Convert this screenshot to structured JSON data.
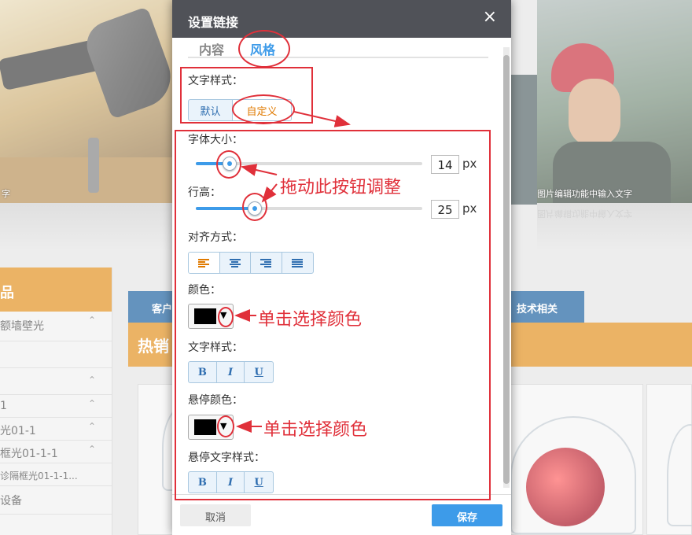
{
  "background": {
    "caption_left": "字",
    "caption_right": "图片编辑功能中输入文字",
    "caption_right_mirror": "图片编辑功能中输入文字",
    "sidebar_title": "品",
    "sidebar_items": [
      {
        "label": "额墙壁光",
        "chevron": "⌃"
      },
      {
        "label": "",
        "chevron": ""
      },
      {
        "label": "",
        "chevron": "⌃"
      },
      {
        "label": "1",
        "chevron": "⌃"
      },
      {
        "label": "光01-1",
        "chevron": "⌃"
      },
      {
        "label": "框光01-1-1",
        "chevron": "⌃"
      },
      {
        "label": "诊隔框光01-1-1...",
        "chevron": ""
      },
      {
        "label": "设备",
        "chevron": ""
      }
    ],
    "tabs": [
      "客户",
      "技术相关"
    ],
    "hot_title": "热销"
  },
  "dialog": {
    "title": "设置链接",
    "close_icon": "×",
    "tabs": [
      {
        "label": "内容",
        "active": false
      },
      {
        "label": "风格",
        "active": true
      }
    ],
    "text_style_label": "文字样式：",
    "text_style_options": [
      {
        "label": "默认",
        "selected": false
      },
      {
        "label": "自定义",
        "selected": true
      }
    ],
    "font_size_label": "字体大小：",
    "font_size_value": "14",
    "font_size_unit": "px",
    "font_size_level": 0.15,
    "line_height_label": "行高：",
    "line_height_value": "25",
    "line_height_unit": "px",
    "line_height_level": 0.26,
    "align_label": "对齐方式：",
    "align_options": [
      "align-left",
      "align-center",
      "align-right",
      "align-justify"
    ],
    "align_selected": "align-left",
    "color_label": "颜色：",
    "color_value": "#000000",
    "dropdown_glyph": "▼",
    "font_style_label": "文字样式：",
    "font_style_buttons": [
      "B",
      "I",
      "U"
    ],
    "hover_color_label": "悬停颜色：",
    "hover_color_value": "#000000",
    "hover_style_label": "悬停文字样式：",
    "hover_style_buttons": [
      "B",
      "I",
      "U"
    ],
    "cancel_label": "取消",
    "save_label": "保存"
  },
  "annotations": {
    "drag_hint": "拖动此按钮调整",
    "color_hint_1": "单击选择颜色",
    "color_hint_2": "单击选择颜色",
    "color": "#e0303a"
  }
}
